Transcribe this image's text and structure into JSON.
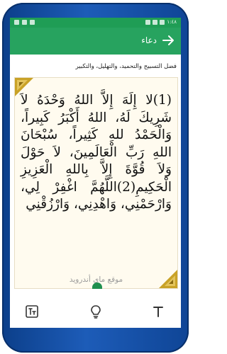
{
  "statusbar": {
    "time": "١:٤٨"
  },
  "appbar": {
    "title": "دعاء"
  },
  "subtitle": "فضل التسبيح والتحميد، والتهليل، والتكبير",
  "dua": {
    "text": "(1)لا إِلَهَ إِلاَّ اللهُ وَحْدَهُ لاَ شَرِيكَ لَهُ، اللهُ أَكْبَرُ كَبِيراً، وَالْحَمْدُ للهِ كَثِيراً، سُبْحَانَ اللهِ رَبِّ الْعَالَمِينَ، لاَ حَوْلَ وَلاَ قُوَّةَ إِلاَّ بِاللهِ الْعَزِيزِ الْحَكِيمِ(2)اللَّهُمَّ اغْفِرْ لِي، وَارْحَمْنِي، وَاهْدِنِي، وَارْزُقْنِي"
  },
  "watermark": "موقع ماي أندرويد",
  "bottombar": {
    "icons": [
      "text-format-icon",
      "lightbulb-icon",
      "font-size-icon"
    ]
  },
  "colors": {
    "primary": "#27a35f",
    "statusbar": "#1f9d55",
    "card_bg": "#fffbef",
    "ornament": "#c9a227"
  }
}
